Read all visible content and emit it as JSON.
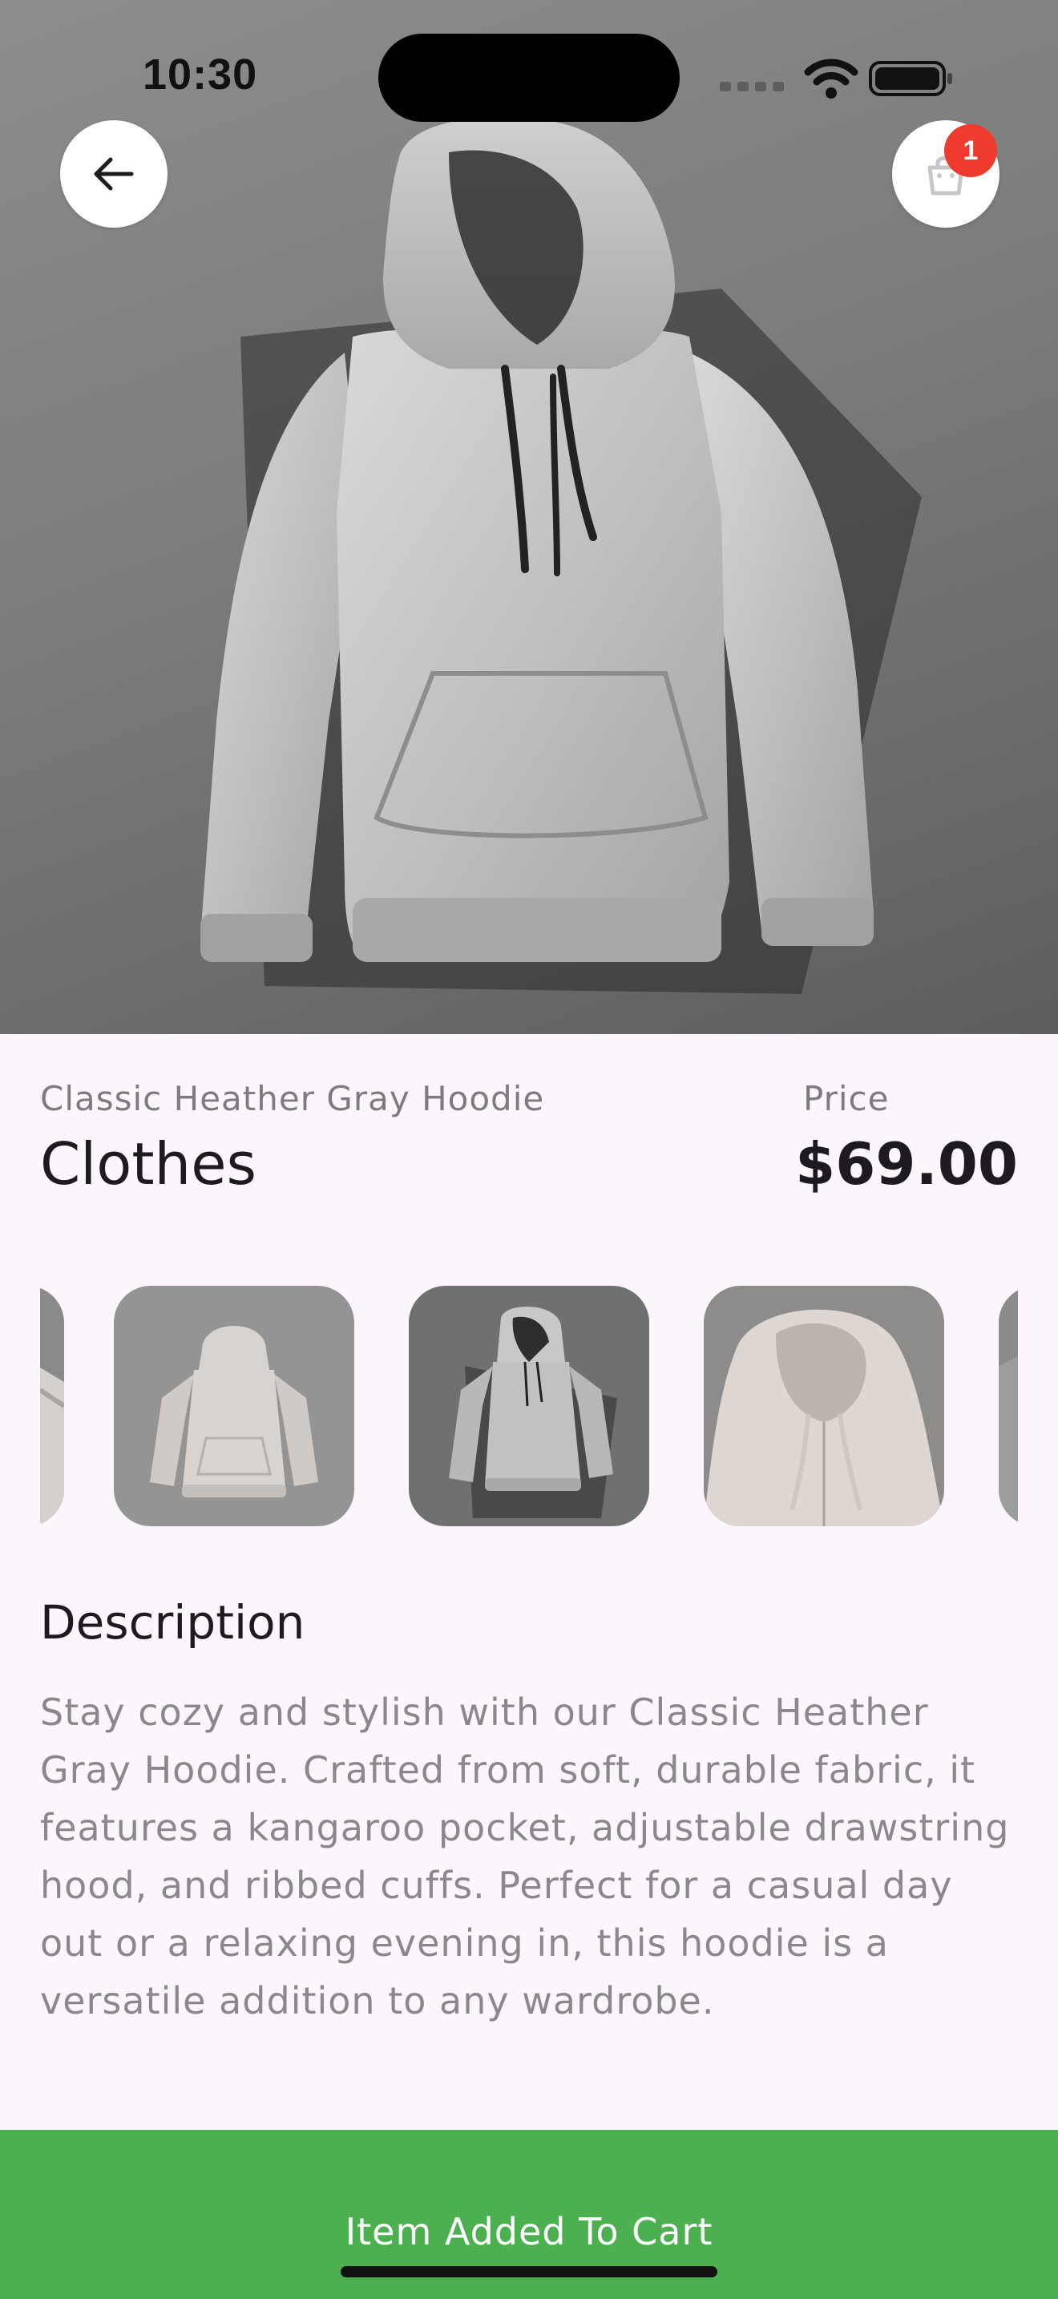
{
  "status_bar": {
    "time": "10:30"
  },
  "header": {
    "back_icon": "arrow-left-icon",
    "cart_icon": "shopping-bag-icon",
    "cart_badge_count": "1"
  },
  "product": {
    "name": "Classic Heather Gray Hoodie",
    "category": "Clothes",
    "price_label": "Price",
    "price": "$69.00"
  },
  "gallery": {
    "thumbnails": [
      "hoodie-partial-left",
      "hoodie-front-light",
      "hoodie-front-shadow",
      "hoodie-hood-closeup",
      "hoodie-partial-right"
    ]
  },
  "description": {
    "title": "Description",
    "text": "Stay cozy and stylish with our Classic Heather Gray Hoodie. Crafted from soft, durable fabric, it features a kangaroo pocket, adjustable drawstring hood, and ribbed cuffs. Perfect for a casual day out or a relaxing evening in, this hoodie is a versatile addition to any wardrobe."
  },
  "cart_bar": {
    "label": "Item Added To Cart",
    "color": "#4caf50"
  },
  "colors": {
    "background": "#fdf5fc",
    "badge": "#ee3b2e",
    "title_text": "#1d1b20",
    "muted_text": "#8b888d"
  }
}
